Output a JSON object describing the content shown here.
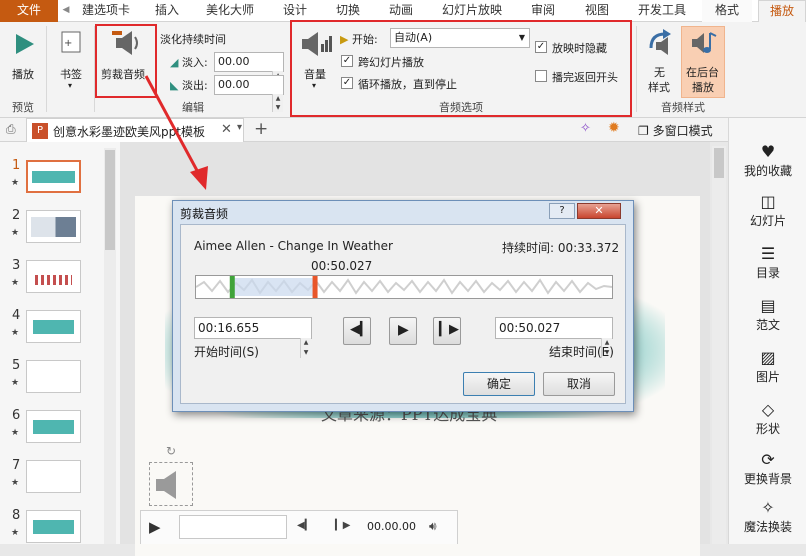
{
  "tabs": {
    "file": "文件",
    "items": [
      "建选项卡",
      "插入",
      "美化大师",
      "设计",
      "切换",
      "动画",
      "幻灯片放映",
      "审阅",
      "视图",
      "开发工具",
      "格式",
      "播放"
    ]
  },
  "ribbon": {
    "play": "播放",
    "bookmark": "书签",
    "trim": "剪裁音频",
    "fade_title": "淡化持续时间",
    "fade_in_label": "淡入:",
    "fade_in_value": "00.00",
    "fade_out_label": "淡出:",
    "fade_out_value": "00.00",
    "volume": "音量",
    "start_label": "开始:",
    "start_value": "自动(A)",
    "cross_slides": "跨幻灯片播放",
    "loop": "循环播放，直到停止",
    "hide_during_show": "放映时隐藏",
    "rewind": "播完返回开头",
    "no_style_1": "无",
    "no_style_2": "样式",
    "bg_play_1": "在后台",
    "bg_play_2": "播放",
    "group_preview": "预览",
    "group_edit": "编辑",
    "group_audio_options": "音频选项",
    "group_audio_style": "音频样式"
  },
  "doc": {
    "tab_title": "创意水彩墨迹欧美风ppt模板",
    "multi_window": "多窗口模式"
  },
  "slides": [
    {
      "num": "1",
      "accent": "#4fb6b0"
    },
    {
      "num": "2",
      "accent": "#6d7f94"
    },
    {
      "num": "3",
      "accent": "#c44f4f"
    },
    {
      "num": "4",
      "accent": "#4fb6b0"
    },
    {
      "num": "5",
      "accent": "#dddddd"
    },
    {
      "num": "6",
      "accent": "#4fb6b0"
    },
    {
      "num": "7",
      "accent": "#dddddd"
    },
    {
      "num": "8",
      "accent": "#4fb6b0"
    }
  ],
  "right_panel": {
    "favorites": "我的收藏",
    "slides": "幻灯片",
    "toc": "目录",
    "samples": "范文",
    "images": "图片",
    "shapes": "形状",
    "change_bg": "更换背景",
    "magic": "魔法换装"
  },
  "slide_text": "文章来源：PPT达成宝典",
  "dialog": {
    "title": "剪裁音频",
    "track": "Aimee Allen - Change In Weather",
    "duration": "持续时间: 00:33.372",
    "marker": "00:50.027",
    "start_value": "00:16.655",
    "end_value": "00:50.027",
    "start_label": "开始时间(S)",
    "end_label": "结束时间(E)",
    "ok": "确定",
    "cancel": "取消",
    "start_fraction": 0.086,
    "end_fraction": 0.285
  },
  "player": {
    "time": "00.00.00"
  },
  "colors": {
    "accent_orange": "#c55a11",
    "highlight_red": "#e0292b",
    "teal": "#4fb6b0",
    "start_marker": "#3fa33a",
    "end_marker": "#e8562a"
  }
}
